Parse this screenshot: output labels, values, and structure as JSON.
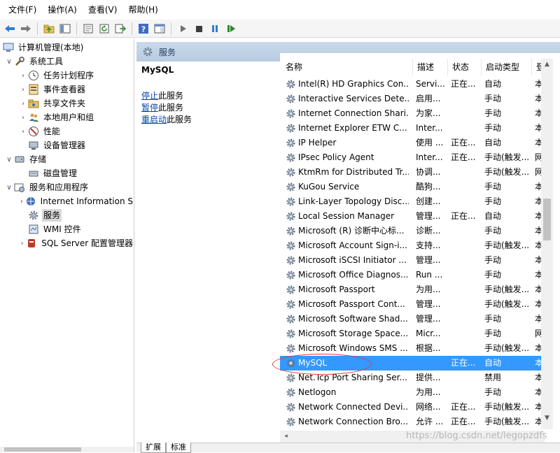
{
  "menu": [
    "文件(F)",
    "操作(A)",
    "查看(V)",
    "帮助(H)"
  ],
  "toolbar_icons": [
    "back-icon",
    "forward-icon",
    "up-folder-icon",
    "show-tree-icon",
    "properties-icon",
    "refresh-icon",
    "export-icon",
    "help-icon",
    "show-pane-icon",
    "start-icon",
    "stop-icon",
    "pause-icon",
    "resume-icon"
  ],
  "tree": [
    {
      "label": "计算机管理(本地)",
      "caret": "",
      "icon": "computer-icon"
    },
    {
      "label": "系统工具",
      "caret": "∨",
      "icon": "tools-icon"
    },
    {
      "label": "任务计划程序",
      "caret": "›",
      "icon": "clock-icon"
    },
    {
      "label": "事件查看器",
      "caret": "›",
      "icon": "event-viewer-icon"
    },
    {
      "label": "共享文件夹",
      "caret": "›",
      "icon": "shared-folder-icon"
    },
    {
      "label": "本地用户和组",
      "caret": "›",
      "icon": "users-icon"
    },
    {
      "label": "性能",
      "caret": "›",
      "icon": "performance-icon"
    },
    {
      "label": "设备管理器",
      "caret": "",
      "icon": "device-manager-icon"
    },
    {
      "label": "存储",
      "caret": "∨",
      "icon": "storage-icon"
    },
    {
      "label": "磁盘管理",
      "caret": "",
      "icon": "disk-icon"
    },
    {
      "label": "服务和应用程序",
      "caret": "∨",
      "icon": "services-apps-icon"
    },
    {
      "label": "Internet Information S",
      "caret": "›",
      "icon": "iis-icon"
    },
    {
      "label": "服务",
      "caret": "",
      "icon": "gear-icon"
    },
    {
      "label": "WMI 控件",
      "caret": "",
      "icon": "wmi-icon"
    },
    {
      "label": "SQL Server 配置管理器",
      "caret": "›",
      "icon": "sql-server-icon"
    }
  ],
  "services_header": "服务",
  "selected_service": "MySQL",
  "actions": [
    {
      "link": "停止",
      "text": "此服务"
    },
    {
      "link": "暂停",
      "text": "此服务"
    },
    {
      "link": "重启动",
      "text": "此服务"
    }
  ],
  "columns": [
    "名称",
    "描述",
    "状态",
    "启动类型",
    "登"
  ],
  "services": [
    {
      "name": "Intel(R) HD Graphics Con...",
      "desc": "Servi...",
      "status": "正在...",
      "start": "自动",
      "login": "本"
    },
    {
      "name": "Interactive Services Dete...",
      "desc": "启用...",
      "status": "",
      "start": "手动",
      "login": "本"
    },
    {
      "name": "Internet Connection Shari...",
      "desc": "为家...",
      "status": "",
      "start": "手动",
      "login": "本"
    },
    {
      "name": "Internet Explorer ETW C...",
      "desc": "Inter...",
      "status": "",
      "start": "手动",
      "login": "本"
    },
    {
      "name": "IP Helper",
      "desc": "使用 ...",
      "status": "正在...",
      "start": "自动",
      "login": "本"
    },
    {
      "name": "IPsec Policy Agent",
      "desc": "Inter...",
      "status": "正在...",
      "start": "手动(触发...",
      "login": "网"
    },
    {
      "name": "KtmRm for Distributed Tr...",
      "desc": "协调...",
      "status": "",
      "start": "手动(触发...",
      "login": "网"
    },
    {
      "name": "KuGou Service",
      "desc": "酷狗...",
      "status": "",
      "start": "手动",
      "login": "本"
    },
    {
      "name": "Link-Layer Topology Disc...",
      "desc": "创建...",
      "status": "",
      "start": "手动",
      "login": "本"
    },
    {
      "name": "Local Session Manager",
      "desc": "管理...",
      "status": "正在...",
      "start": "自动",
      "login": "本"
    },
    {
      "name": "Microsoft (R) 诊断中心标...",
      "desc": "诊断...",
      "status": "",
      "start": "手动",
      "login": "本"
    },
    {
      "name": "Microsoft Account Sign-i...",
      "desc": "支持...",
      "status": "",
      "start": "手动(触发...",
      "login": "本"
    },
    {
      "name": "Microsoft iSCSI Initiator ...",
      "desc": "管理...",
      "status": "",
      "start": "手动",
      "login": "本"
    },
    {
      "name": "Microsoft Office Diagnos...",
      "desc": "Run ...",
      "status": "",
      "start": "手动",
      "login": "本"
    },
    {
      "name": "Microsoft Passport",
      "desc": "为用...",
      "status": "",
      "start": "手动(触发...",
      "login": "本"
    },
    {
      "name": "Microsoft Passport Cont...",
      "desc": "管理...",
      "status": "",
      "start": "手动(触发...",
      "login": "本"
    },
    {
      "name": "Microsoft Software Shad...",
      "desc": "管理...",
      "status": "",
      "start": "手动",
      "login": "本"
    },
    {
      "name": "Microsoft Storage Space...",
      "desc": "Micr...",
      "status": "",
      "start": "手动",
      "login": "网"
    },
    {
      "name": "Microsoft Windows SMS ...",
      "desc": "根据...",
      "status": "",
      "start": "手动(触发...",
      "login": "本"
    },
    {
      "name": "MySQL",
      "desc": "",
      "status": "正在...",
      "start": "自动",
      "login": "本",
      "selected": true
    },
    {
      "name": "Net.Tcp Port Sharing Ser...",
      "desc": "提供...",
      "status": "",
      "start": "禁用",
      "login": "本"
    },
    {
      "name": "Netlogon",
      "desc": "为用...",
      "status": "",
      "start": "手动",
      "login": "本"
    },
    {
      "name": "Network Connected Devi...",
      "desc": "网络...",
      "status": "正在...",
      "start": "手动(触发...",
      "login": "本"
    },
    {
      "name": "Network Connection Bro...",
      "desc": "允许 ...",
      "status": "正在...",
      "start": "手动(触发...",
      "login": "本"
    }
  ],
  "bottom_tabs": [
    "扩展",
    "标准"
  ],
  "watermark": "https://blog.csdn.net/legopzdfs"
}
